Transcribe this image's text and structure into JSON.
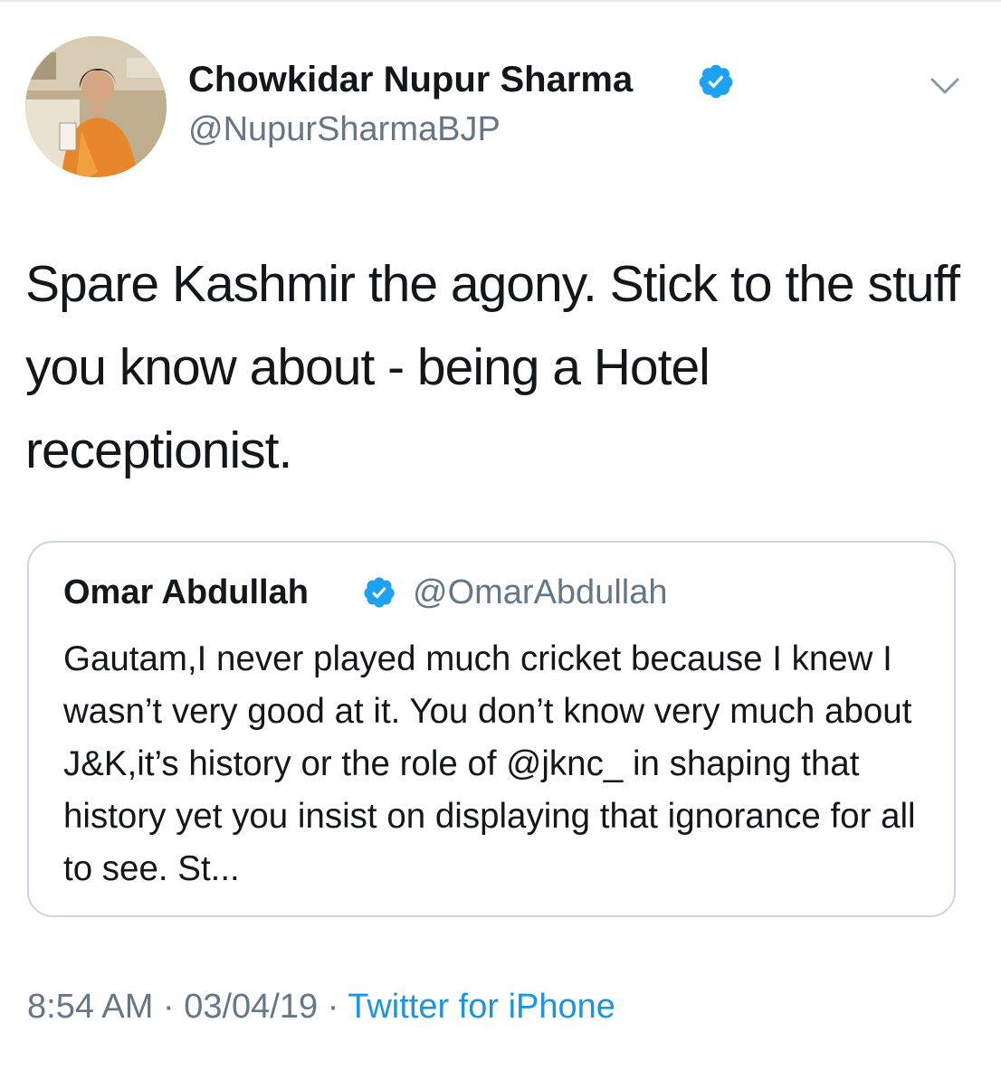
{
  "tweet": {
    "display_name": "Chowkidar Nupur Sharma",
    "handle": "@NupurSharmaBJP",
    "text": "Spare Kashmir the agony. Stick to the stuff you know about - being a Hotel receptionist.",
    "time": "8:54 AM",
    "separator": "·",
    "date": "03/04/19",
    "source": "Twitter for iPhone",
    "verified_icon": "verified-badge-icon",
    "menu_icon": "chevron-down-icon"
  },
  "quoted_tweet": {
    "display_name": "Omar Abdullah",
    "handle": "@OmarAbdullah",
    "text": "Gautam,I never played much cricket because I knew I wasn’t very good at it. You don’t know very much about J&K,it’s history or the role of @jknc_ in shaping that history yet you insist on displaying that ignorance for all to see. St..."
  },
  "colors": {
    "text_primary": "#14171a",
    "text_secondary": "#657786",
    "link": "#1b95e0",
    "verified": "#1da1f2",
    "border": "#ccd6dd"
  }
}
